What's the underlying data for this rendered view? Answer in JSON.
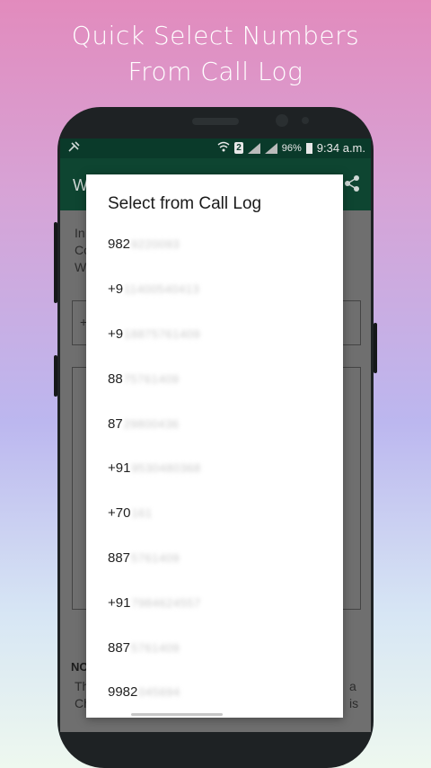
{
  "headline": {
    "line1": "Quick Select Numbers",
    "line2": "From Call Log"
  },
  "status_bar": {
    "sim": "2",
    "battery": "96%",
    "time": "9:34 a.m."
  },
  "appbar": {
    "title": "W"
  },
  "background_snippets": {
    "line_a": "In",
    "line_b": "Co",
    "line_c": "W",
    "field_prefix": "+",
    "note_title": "NO",
    "note_line1": "Th",
    "note_line1_end": "a",
    "note_line2": "Ch",
    "note_line2_end": "is"
  },
  "dialog": {
    "title": "Select from Call Log",
    "items": [
      {
        "visible": "982",
        "hidden": "9220093"
      },
      {
        "visible": "+9",
        "hidden": "11400540413"
      },
      {
        "visible": "+9",
        "hidden": "18875761409"
      },
      {
        "visible": "88",
        "hidden": "75761409"
      },
      {
        "visible": "87",
        "hidden": "29800436"
      },
      {
        "visible": "+91",
        "hidden": "9530480368"
      },
      {
        "visible": "+70",
        "hidden": "161"
      },
      {
        "visible": "887",
        "hidden": "5761409"
      },
      {
        "visible": "+91",
        "hidden": "7984624557"
      },
      {
        "visible": "887",
        "hidden": "5761409"
      },
      {
        "visible": "9982",
        "hidden": "045694"
      }
    ]
  },
  "icons": {
    "statusbar_left": "satellite-icon",
    "wifi": "wifi-icon",
    "share": "share-icon"
  }
}
